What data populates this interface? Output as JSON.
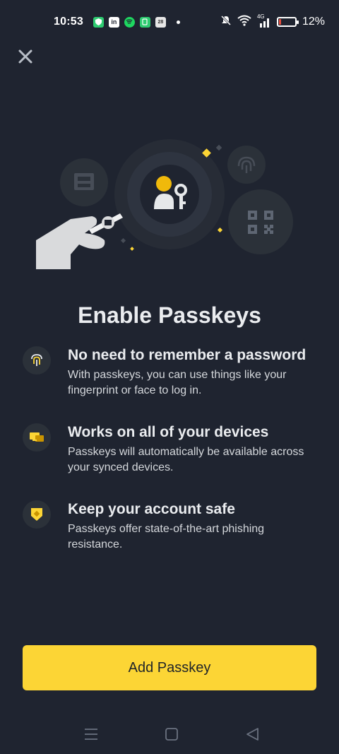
{
  "status_bar": {
    "time": "10:53",
    "notifications": [
      "shield-app-icon",
      "linkedin-icon",
      "spotify-icon",
      "green-app-icon",
      "calendar-icon"
    ],
    "calendar_day": "28",
    "network_label": "4G",
    "battery_percent": "12%",
    "battery_level": 0.12
  },
  "header": {
    "close_icon": "close-icon"
  },
  "title": "Enable Passkeys",
  "features": [
    {
      "icon": "fingerprint-icon",
      "heading": "No need to remember a password",
      "description": "With passkeys, you can use things like your fingerprint or face to log in."
    },
    {
      "icon": "devices-icon",
      "heading": "Works on all of your devices",
      "description": "Passkeys will automatically be available across your synced devices."
    },
    {
      "icon": "shield-icon",
      "heading": "Keep your account safe",
      "description": "Passkeys offer state-of-the-art phishing resistance."
    }
  ],
  "cta": {
    "label": "Add Passkey"
  },
  "nav_bar": {
    "icons": [
      "menu-icon",
      "home-icon",
      "back-icon"
    ]
  },
  "colors": {
    "background": "#1f2430",
    "accent": "#fcd535",
    "icon_circle": "#2b3139"
  }
}
